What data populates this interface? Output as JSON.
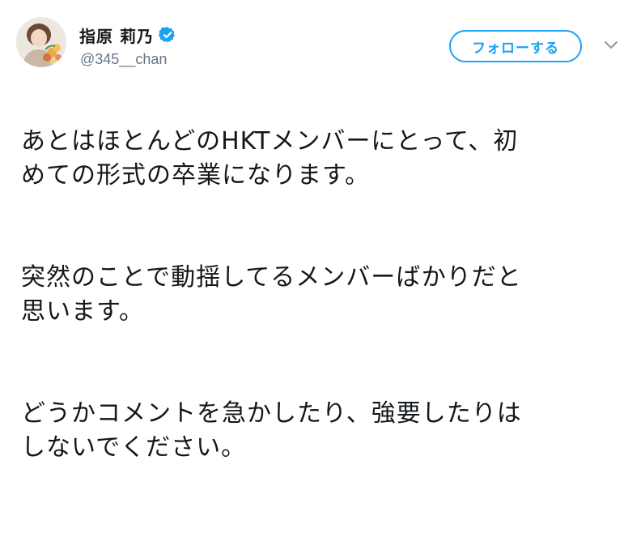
{
  "user": {
    "display_name": "指原 莉乃",
    "handle": "@345__chan",
    "verified": true,
    "avatar_icon": "profile-photo-avatar"
  },
  "actions": {
    "follow_label": "フォローする",
    "more_icon": "chevron-down-icon"
  },
  "tweet": {
    "paragraphs": [
      "あとはほとんどのHKTメンバーにとって、初\nめての形式の卒業になります。",
      "突然のことで動揺してるメンバーばかりだと\n思います。",
      "どうかコメントを急かしたり、強要したりは\nしないでください。"
    ]
  },
  "colors": {
    "accent": "#1da1f2",
    "text": "#14171a",
    "secondary": "#657786"
  }
}
